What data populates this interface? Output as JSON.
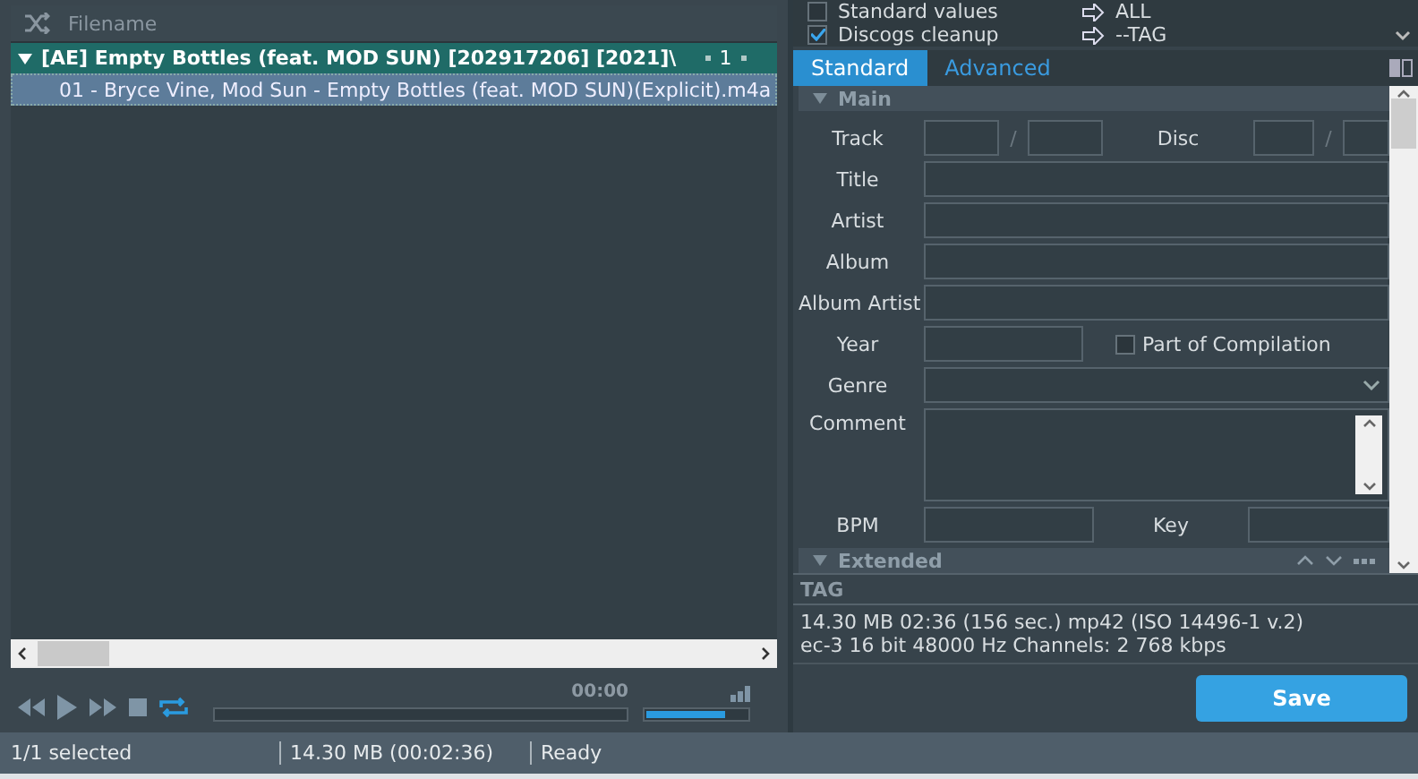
{
  "file_list": {
    "column": "Filename",
    "groups": [
      {
        "title": "[AE]  Empty Bottles (feat. MOD SUN) [202917206] [2021]\\",
        "count": "1",
        "expanded": true,
        "files": [
          {
            "name": "01 - Bryce Vine, Mod Sun - Empty Bottles (feat. MOD SUN)(Explicit).m4a",
            "selected": true
          }
        ]
      }
    ]
  },
  "player": {
    "time": "00:00",
    "position": {
      "level": 0
    },
    "volume": {
      "level": 0.8
    },
    "repeat_on": true
  },
  "actions": [
    {
      "label": "Standard values",
      "checked": false,
      "target": "ALL"
    },
    {
      "label": "Discogs cleanup",
      "checked": true,
      "target": "--TAG"
    }
  ],
  "tabs": [
    {
      "label": "Standard",
      "selected": true
    },
    {
      "label": "Advanced",
      "selected": false
    }
  ],
  "main": {
    "title": "Main",
    "expanded": true,
    "labels": {
      "track": "Track",
      "disc": "Disc",
      "title": "Title",
      "artist": "Artist",
      "album": "Album",
      "album_artist": "Album Artist",
      "year": "Year",
      "genre": "Genre",
      "comment": "Comment",
      "bpm": "BPM",
      "key": "Key"
    },
    "separators": [
      "/",
      "/"
    ],
    "compilation": {
      "label": "Part of Compilation",
      "checked": false
    }
  },
  "extended": {
    "title": "Extended",
    "expanded": true
  },
  "tag_panel": {
    "title": "TAG",
    "info_lines": [
      "14.30 MB  02:36 (156 sec.)  mp42 (ISO 14496-1 v.2)",
      "ec-3  16 bit  48000 Hz  Channels: 2  768 kbps"
    ]
  },
  "save_button": "Save",
  "status_bar": [
    "1/1 selected",
    "14.30 MB (00:02:36)",
    "Ready"
  ]
}
